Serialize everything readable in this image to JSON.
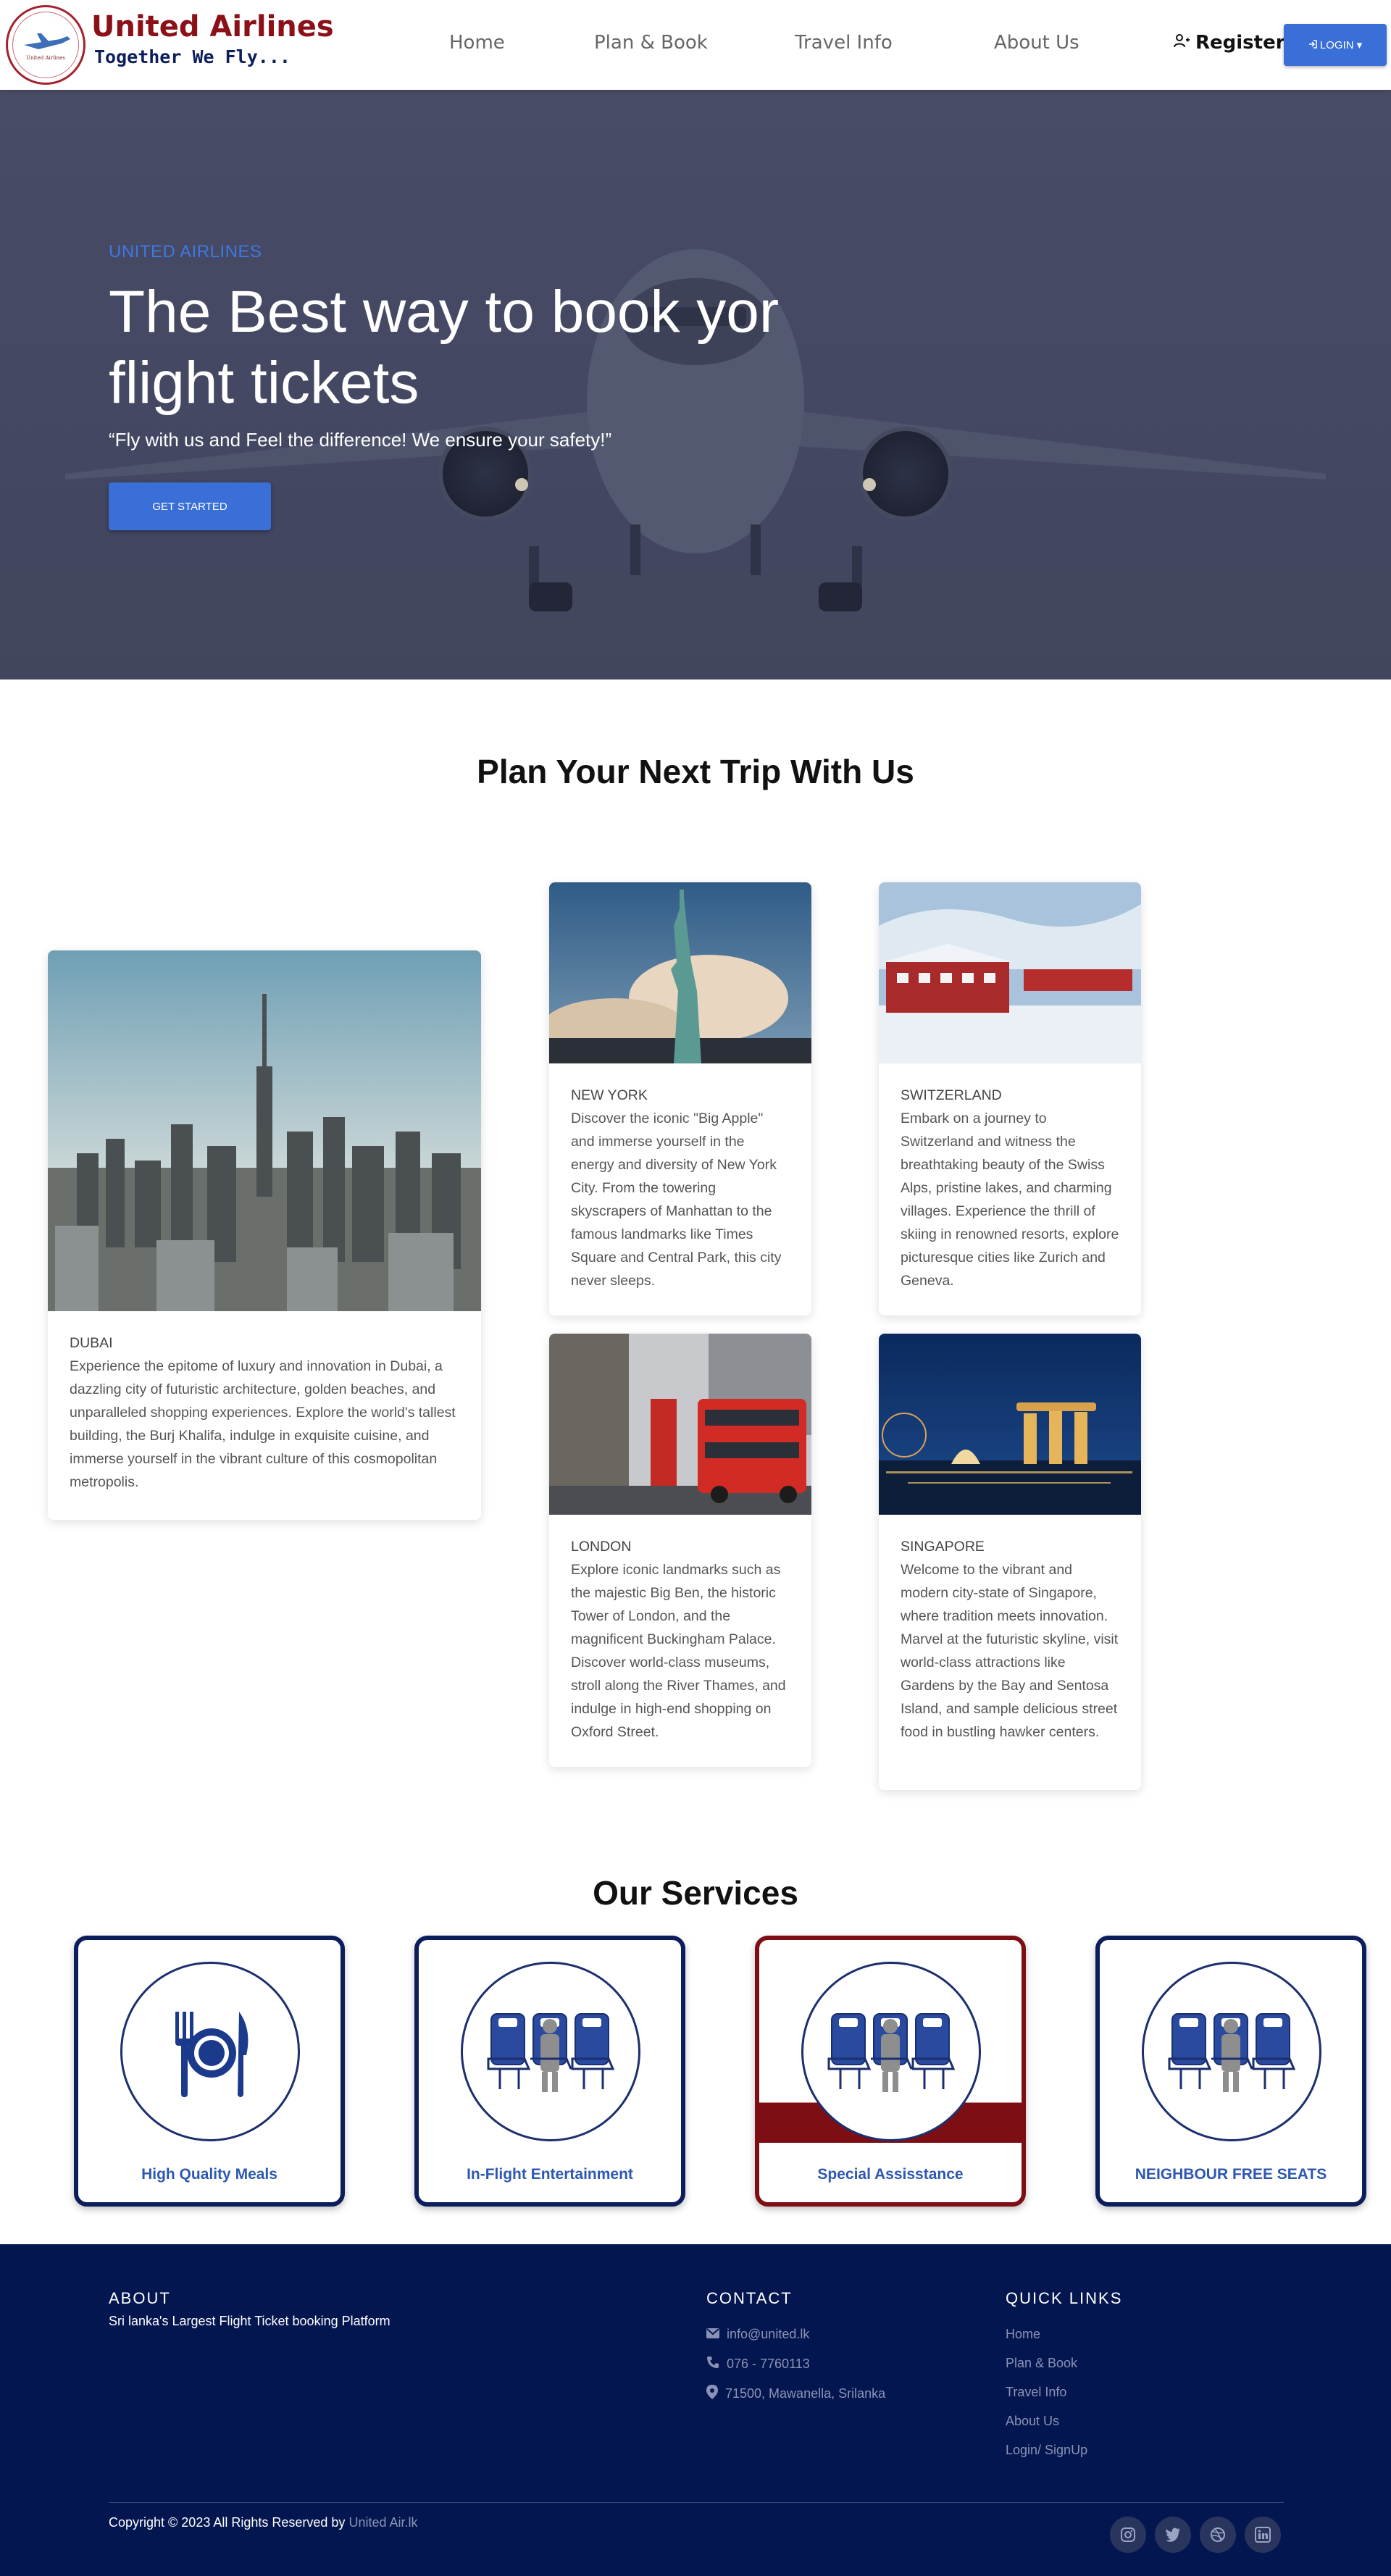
{
  "brand": {
    "name": "United Airlines",
    "tagline": "Together We Fly...",
    "logo_text": "United Airlines"
  },
  "nav": {
    "links": [
      "Home",
      "Plan & Book",
      "Travel Info",
      "About Us"
    ],
    "register": "Register",
    "login": "LOGIN"
  },
  "hero": {
    "kicker": "UNITED AIRLINES",
    "title": "The Best way to book yor flight tickets",
    "subtitle": "“Fly with us and Feel the difference! We ensure your safety!”",
    "cta": "GET STARTED"
  },
  "trip": {
    "title": "Plan Your Next Trip With Us",
    "cards": [
      {
        "name": "DUBAI",
        "text": "Experience the epitome of luxury and innovation in Dubai, a dazzling city of futuristic architecture, golden beaches, and unparalleled shopping experiences. Explore the world's tallest building, the Burj Khalifa, indulge in exquisite cuisine, and immerse yourself in the vibrant culture of this cosmopolitan metropolis."
      },
      {
        "name": "NEW YORK",
        "text": "Discover the iconic \"Big Apple\" and immerse yourself in the energy and diversity of New York City. From the towering skyscrapers of Manhattan to the famous landmarks like Times Square and Central Park, this city never sleeps."
      },
      {
        "name": "SWITZERLAND",
        "text": "Embark on a journey to Switzerland and witness the breathtaking beauty of the Swiss Alps, pristine lakes, and charming villages. Experience the thrill of skiing in renowned resorts, explore picturesque cities like Zurich and Geneva."
      },
      {
        "name": "LONDON",
        "text": "Explore iconic landmarks such as the majestic Big Ben, the historic Tower of London, and the magnificent Buckingham Palace. Discover world-class museums, stroll along the River Thames, and indulge in high-end shopping on Oxford Street."
      },
      {
        "name": "SINGAPORE",
        "text": "Welcome to the vibrant and modern city-state of Singapore, where tradition meets innovation. Marvel at the futuristic skyline, visit world-class attractions like Gardens by the Bay and Sentosa Island, and sample delicious street food in bustling hawker centers."
      }
    ]
  },
  "services": {
    "title": "Our Services",
    "items": [
      {
        "label": "High Quality Meals",
        "icon": "meal-icon"
      },
      {
        "label": "In-Flight Entertainment",
        "icon": "seats-icon"
      },
      {
        "label": "Special Assisstance",
        "icon": "seats-icon"
      },
      {
        "label": "NEIGHBOUR FREE SEATS",
        "icon": "seats-icon"
      }
    ]
  },
  "footer": {
    "about_title": "ABOUT",
    "about_text": "Sri lanka's Largest Flight Ticket booking Platform",
    "contact_title": "CONTACT",
    "email": "info@united.lk",
    "phone": "076 - 7760113",
    "address": "71500, Mawanella, Srilanka",
    "links_title": "QUICK LINKS",
    "links": [
      "Home",
      "Plan & Book",
      "Travel Info",
      "About Us",
      "Login/ SignUp"
    ],
    "copyright": "Copyright © 2023 All Rights Reserved by",
    "copyright_brand": "United Air.lk",
    "social": [
      "instagram-icon",
      "twitter-icon",
      "dribbble-icon",
      "linkedin-icon"
    ]
  },
  "colors": {
    "accent": "#3a6fd8",
    "brand_red": "#8b1018",
    "navy": "#041650"
  }
}
